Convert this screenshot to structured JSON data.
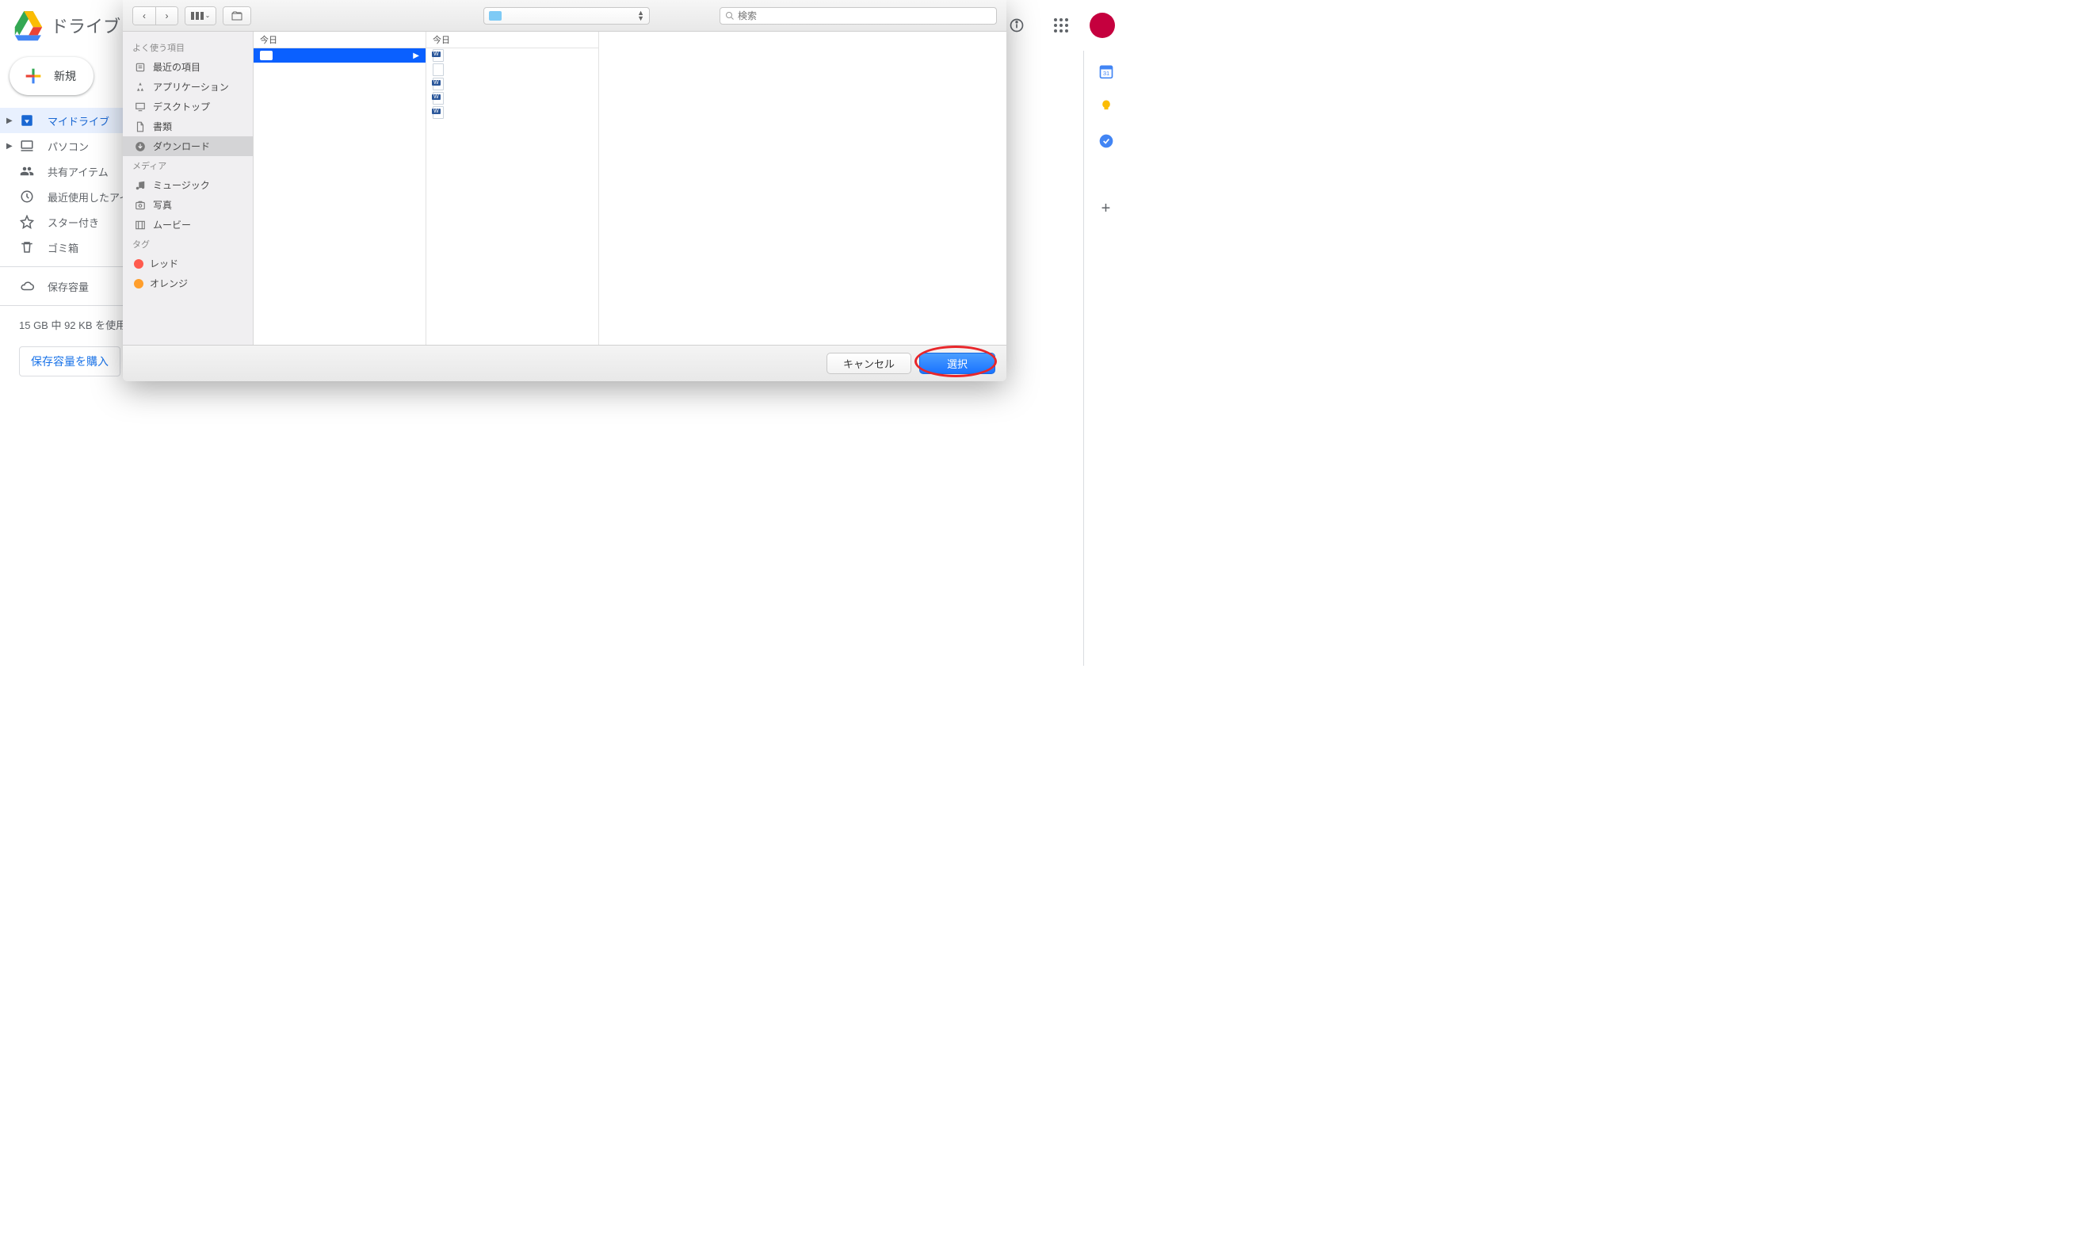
{
  "gd": {
    "title": "ドライブ",
    "new_label": "新規",
    "nav": {
      "mydrive": "マイドライブ",
      "computers": "パソコン",
      "shared": "共有アイテム",
      "recent": "最近使用したアイテム",
      "starred": "スター付き",
      "trash": "ゴミ箱",
      "storage": "保存容量"
    },
    "storage_text": "15 GB 中 92 KB を使用",
    "buy_storage": "保存容量を購入"
  },
  "finder": {
    "search_placeholder": "検索",
    "sidebar": {
      "favorites_header": "よく使う項目",
      "recent": "最近の項目",
      "applications": "アプリケーション",
      "desktop": "デスクトップ",
      "documents": "書類",
      "downloads": "ダウンロード",
      "media_header": "メディア",
      "music": "ミュージック",
      "photos": "写真",
      "movies": "ムービー",
      "tags_header": "タグ",
      "tag_red": "レッド",
      "tag_orange": "オレンジ"
    },
    "col1_header": "今日",
    "col2_header": "今日",
    "folder_row": "",
    "footer": {
      "cancel": "キャンセル",
      "choose": "選択"
    }
  }
}
